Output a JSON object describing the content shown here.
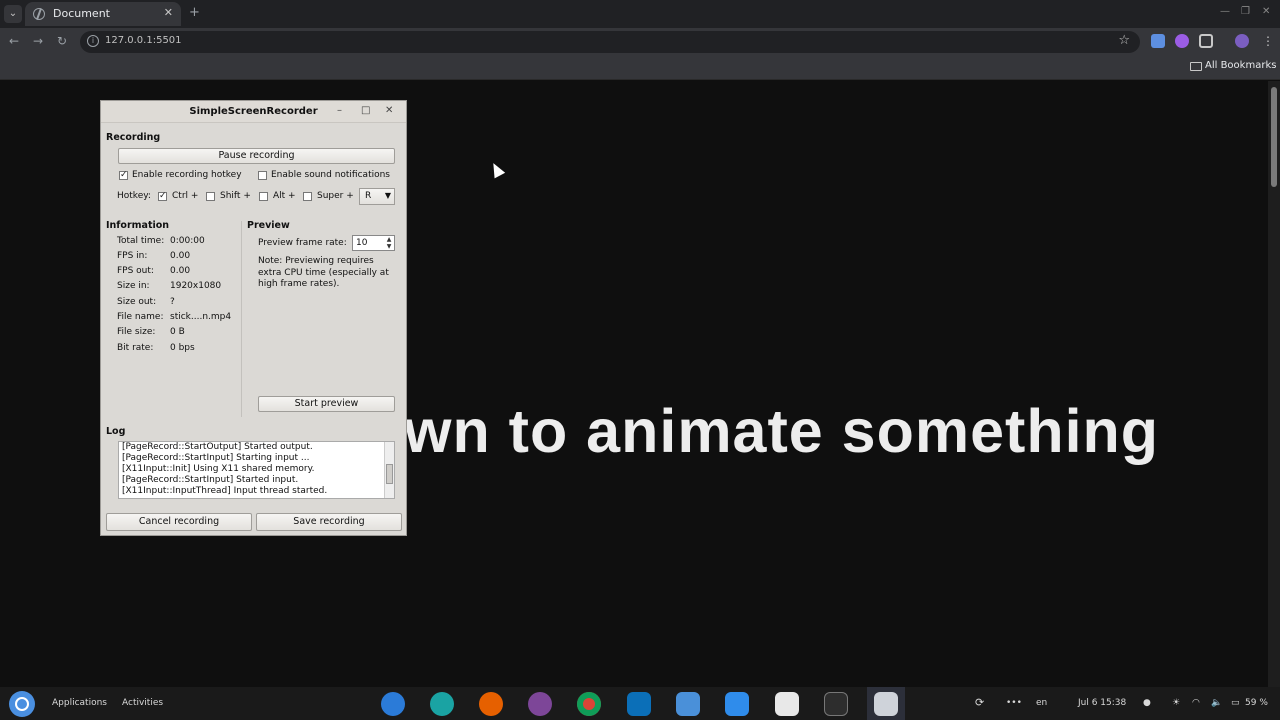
{
  "browser": {
    "tab_title": "Document",
    "url": "127.0.0.1:5501",
    "bookmarks_label": "All Bookmarks"
  },
  "page": {
    "headline": "wn to animate something"
  },
  "ssr": {
    "window_title": "SimpleScreenRecorder",
    "recording_header": "Recording",
    "pause_button": "Pause recording",
    "enable_hotkey_label": "Enable recording hotkey",
    "enable_hotkey_checked": true,
    "enable_sound_label": "Enable sound notifications",
    "enable_sound_checked": false,
    "hotkey_label": "Hotkey:",
    "ctrl_label": "Ctrl +",
    "ctrl_checked": true,
    "shift_label": "Shift +",
    "shift_checked": false,
    "alt_label": "Alt +",
    "alt_checked": false,
    "super_label": "Super +",
    "super_checked": false,
    "key_value": "R",
    "information_header": "Information",
    "info": [
      {
        "key": "Total time:",
        "value": "0:00:00"
      },
      {
        "key": "FPS in:",
        "value": "0.00"
      },
      {
        "key": "FPS out:",
        "value": "0.00"
      },
      {
        "key": "Size in:",
        "value": "1920x1080"
      },
      {
        "key": "Size out:",
        "value": "?"
      },
      {
        "key": "File name:",
        "value": "stick....n.mp4"
      },
      {
        "key": "File size:",
        "value": "0 B"
      },
      {
        "key": "Bit rate:",
        "value": "0 bps"
      }
    ],
    "preview_header": "Preview",
    "preview_rate_label": "Preview frame rate:",
    "preview_rate_value": "10",
    "preview_note": "Note: Previewing requires extra CPU time (especially at high frame rates).",
    "start_preview_button": "Start preview",
    "log_header": "Log",
    "log_lines": [
      "[PageRecord::StartOutput] Started output.",
      "[PageRecord::StartInput] Starting input ...",
      "[X11Input::Init] Using X11 shared memory.",
      "[PageRecord::StartInput] Started input.",
      "[X11Input::InputThread] Input thread started."
    ],
    "cancel_button": "Cancel recording",
    "save_button": "Save recording"
  },
  "taskbar": {
    "applications_label": "Applications",
    "activities_label": "Activities",
    "apps": [
      "thunderbird-icon",
      "edge-icon",
      "firefox-icon",
      "tor-icon",
      "chrome-icon",
      "vscode-icon",
      "files-icon",
      "app-store-icon",
      "text-editor-icon",
      "terminal-icon",
      "screen-recorder-icon"
    ],
    "keyboard_layout": "en",
    "datetime": "Jul 6  15:38",
    "battery": "59 %"
  },
  "colors": {
    "page_bg": "#0f0f0f",
    "headline": "#ededed",
    "ssr_bg": "#dbd9d5",
    "chrome_dark": "#202124",
    "chrome_mid": "#35363a",
    "taskbar": "#1a1a1a"
  }
}
